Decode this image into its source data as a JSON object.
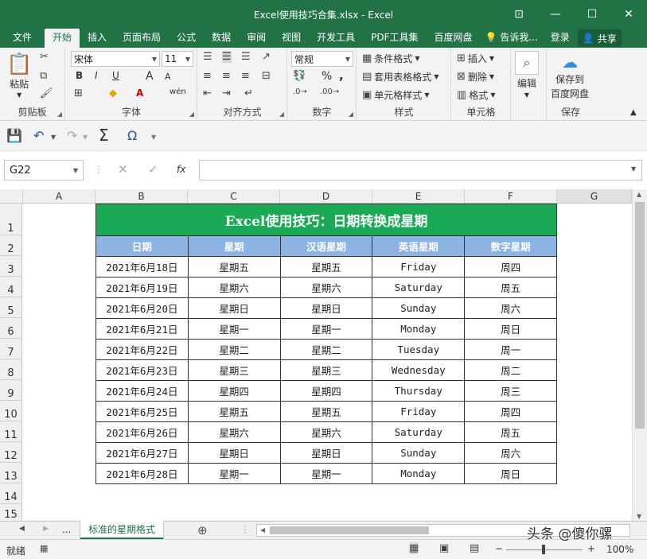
{
  "window": {
    "title": "Excel使用技巧合集.xlsx - Excel"
  },
  "menu": {
    "tabs": [
      "文件",
      "开始",
      "插入",
      "页面布局",
      "公式",
      "数据",
      "审阅",
      "视图",
      "开发工具",
      "PDF工具集",
      "百度网盘"
    ],
    "tell_me": "告诉我...",
    "login": "登录",
    "share": "共享"
  },
  "ribbon": {
    "clipboard": {
      "paste": "粘贴",
      "label": "剪贴板"
    },
    "font": {
      "name": "宋体",
      "size": "11",
      "bold": "B",
      "italic": "I",
      "underline": "U",
      "grow": "A",
      "shrink": "A",
      "wen": "wén",
      "label": "字体"
    },
    "alignment": {
      "label": "对齐方式"
    },
    "number": {
      "format": "常规",
      "percent": "%",
      "comma": ",",
      "label": "数字"
    },
    "styles": {
      "conditional": "条件格式",
      "table": "套用表格格式",
      "cell": "单元格样式",
      "label": "样式"
    },
    "cells": {
      "insert": "插入",
      "delete": "删除",
      "format": "格式",
      "label": "单元格"
    },
    "editing": {
      "label": "编辑"
    },
    "save": {
      "label1": "保存到",
      "label2": "百度网盘",
      "group": "保存"
    }
  },
  "formula_bar": {
    "name_box": "G22",
    "fx": "fx",
    "value": ""
  },
  "columns": [
    "A",
    "B",
    "C",
    "D",
    "E",
    "F",
    "G"
  ],
  "rows": [
    "1",
    "2",
    "3",
    "4",
    "5",
    "6",
    "7",
    "8",
    "9",
    "10",
    "11",
    "12",
    "13",
    "14",
    "15"
  ],
  "table": {
    "title": "Excel使用技巧：日期转换成星期",
    "headers": [
      "日期",
      "星期",
      "汉语星期",
      "英语星期",
      "数字星期"
    ],
    "data": [
      [
        "2021年6月18日",
        "星期五",
        "星期五",
        "Friday",
        "周四"
      ],
      [
        "2021年6月19日",
        "星期六",
        "星期六",
        "Saturday",
        "周五"
      ],
      [
        "2021年6月20日",
        "星期日",
        "星期日",
        "Sunday",
        "周六"
      ],
      [
        "2021年6月21日",
        "星期一",
        "星期一",
        "Monday",
        "周日"
      ],
      [
        "2021年6月22日",
        "星期二",
        "星期二",
        "Tuesday",
        "周一"
      ],
      [
        "2021年6月23日",
        "星期三",
        "星期三",
        "Wednesday",
        "周二"
      ],
      [
        "2021年6月24日",
        "星期四",
        "星期四",
        "Thursday",
        "周三"
      ],
      [
        "2021年6月25日",
        "星期五",
        "星期五",
        "Friday",
        "周四"
      ],
      [
        "2021年6月26日",
        "星期六",
        "星期六",
        "Saturday",
        "周五"
      ],
      [
        "2021年6月27日",
        "星期日",
        "星期日",
        "Sunday",
        "周六"
      ],
      [
        "2021年6月28日",
        "星期一",
        "星期一",
        "Monday",
        "周日"
      ]
    ]
  },
  "sheet_tabs": {
    "more": "...",
    "active": "标准的星期格式"
  },
  "status": {
    "ready": "就绪",
    "zoom": "100%",
    "watermark": "头条 @傻你骡"
  }
}
